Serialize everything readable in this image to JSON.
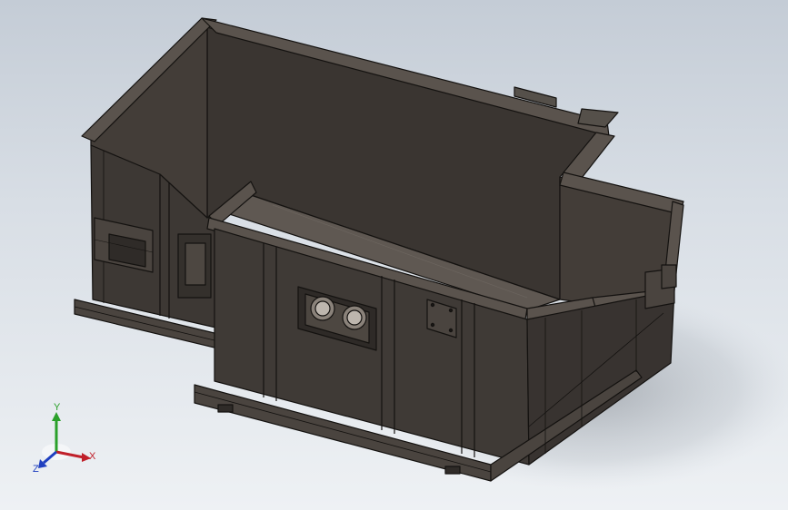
{
  "viewport": {
    "background_top": "#c4ccd6",
    "background_bottom": "#eef1f4"
  },
  "model": {
    "body_color": "#3f3a36",
    "edge_color": "#141210",
    "floor_color": "#615a54",
    "interior_color": "#3a3531",
    "highlight_color": "#5a534d"
  },
  "triad": {
    "x_label": "X",
    "y_label": "Y",
    "z_label": "Z",
    "x_color": "#c0202a",
    "y_color": "#2aa02a",
    "z_color": "#2040c0"
  }
}
